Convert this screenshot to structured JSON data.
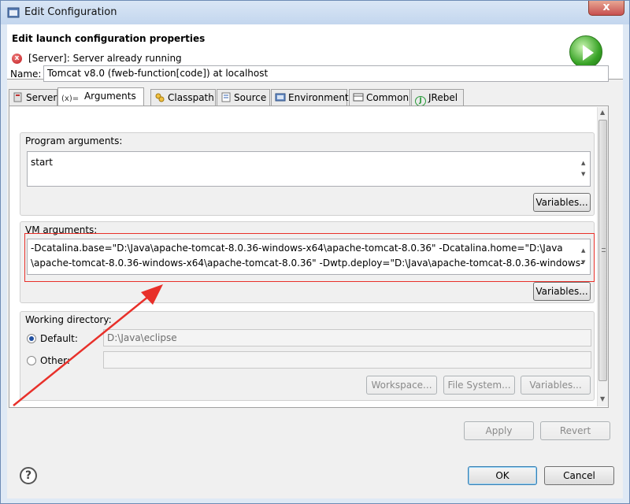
{
  "window": {
    "title": "Edit Configuration",
    "close_label": "x"
  },
  "header": {
    "title": "Edit launch configuration properties",
    "error_message": "[Server]: Server already running",
    "error_glyph": "x"
  },
  "name": {
    "label": "Name:",
    "value": "Tomcat v8.0 (fweb-function[code]) at localhost"
  },
  "tabs": [
    {
      "label": "Server",
      "icon": "server-icon"
    },
    {
      "label": "Arguments",
      "icon": "arguments-icon"
    },
    {
      "label": "Classpath",
      "icon": "classpath-icon"
    },
    {
      "label": "Source",
      "icon": "source-icon"
    },
    {
      "label": "Environment",
      "icon": "environment-icon"
    },
    {
      "label": "Common",
      "icon": "common-icon"
    },
    {
      "label": "JRebel",
      "icon": "jrebel-icon"
    }
  ],
  "tab_icon_glyphs": {
    "arguments": "(x)=",
    "jrebel": "J"
  },
  "program_args": {
    "label": "Program arguments:",
    "value": "start",
    "variables_label": "Variables..."
  },
  "vm_args": {
    "label": "VM arguments:",
    "line1": "-Dcatalina.base=\"D:\\Java\\apache-tomcat-8.0.36-windows-x64\\apache-tomcat-8.0.36\" -Dcatalina.home=\"D:\\Java",
    "line2": "\\apache-tomcat-8.0.36-windows-x64\\apache-tomcat-8.0.36\" -Dwtp.deploy=\"D:\\Java\\apache-tomcat-8.0.36-windows-",
    "variables_label": "Variables..."
  },
  "working_dir": {
    "label": "Working directory:",
    "default_label": "Default:",
    "default_value": "D:\\Java\\eclipse",
    "other_label": "Other:",
    "other_value": "",
    "workspace_label": "Workspace...",
    "filesystem_label": "File System...",
    "variables_label": "Variables..."
  },
  "actions": {
    "apply_label": "Apply",
    "revert_label": "Revert",
    "ok_label": "OK",
    "cancel_label": "Cancel",
    "help_glyph": "?"
  },
  "colors": {
    "annotation": "#e8302a",
    "run_icon": "#38a326"
  }
}
